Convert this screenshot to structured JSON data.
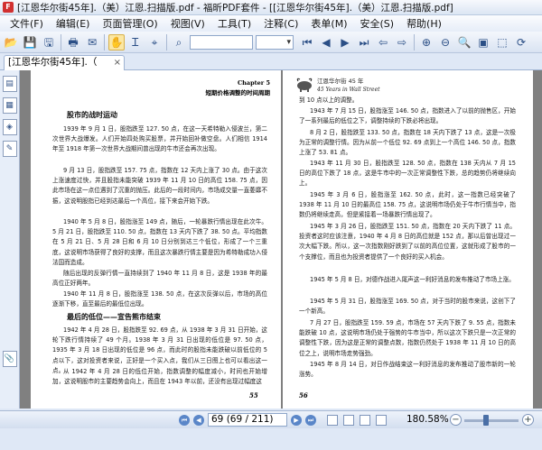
{
  "window": {
    "title": "[江恩华尔街45年].（美）江恩.扫描版.pdf - 福昕PDF套件 - [[江恩华尔街45年].（美）江恩.扫描版.pdf]"
  },
  "menu": [
    "文件(F)",
    "编辑(E)",
    "页面管理(O)",
    "视图(V)",
    "工具(T)",
    "注释(C)",
    "表单(M)",
    "安全(S)",
    "帮助(H)"
  ],
  "toolbar": {
    "search_placeholder": "",
    "zoom_select": ""
  },
  "tab": {
    "label": "[江恩华尔街45年].（",
    "close": "×"
  },
  "left_page": {
    "chapter": "Chapter 5",
    "chapter_sub": "短期价格调整的时间周期",
    "section1": "股市的战时运动",
    "p1": "1939 年 9 月 1 日，股指跌至 127. 50 点，在这一天希特勒入侵波兰，第二次世界大战爆发。人们开始四处购买股票，并开始回补做空盘。人们相信 1914 年至 1918 年第一次世界大战期间曾出现的牛市还会再次出现。",
    "p2": "9 月 13 日，股指跌至 157. 75 点，指数在 12 天内上涨了 30 点。由于这次上涨速度过快，并且股指未能突破 1939 年 11 月 10 日的高位 158. 75 点，因此市场在这一点位遇到了沉重的抛压。此后的一段时间内，市场成交量一直萎靡不振，这说明股指已经到达最后一个高位，接下来会开始下跌。",
    "p3": "1940 年 5 月 8 日，股指涨至 149 点，随后，一轮暴跌行情出现在此次牛。5 月 21 日，股指跌至 110. 50 点，指数在 13 天内下跌了 38. 50 点。平均指数在 5 月 21 日、5 月 28 日和 6 月 10 日分别到达三个低位，形成了一个三重底，这说明市场获得了良好的支撑，而且这次暴跌行情主要是因为希特勒成功入侵法国而造成。",
    "p4": "随后出现的反弹行情一直持续到了 1940 年 11 月 8 日，这是 1938 年的最高位正好两年。",
    "p5": "1940 年 11 月 8 日，股指涨至 138. 50 点，在这次反弹以后，市场的高位逐渐下移，直至最后的最低位出现。",
    "section2": "最后的低位——宣告熊市结束",
    "p6": "1942 年 4 月 28 日，股指跌至 92. 69 点，从 1938 年 3 月 31 日开始，这轮下跌行情持续了 49 个月。1938 年 3 月 31 日出现的低位是 97. 50 点，1935 年 3 月 18 日出现的低位是 96 点，而此时的股指未能跌破以前低位的 5 点以下，这对投资者来说，正好是一个买入点，我们从三日图上也可以看出这一点。",
    "p7": "从 1942 年 4 月 28 日的低位开始，指数调整的幅度减小，时间也开始增加，这说明股市的主要趋势会向上，而且在 1943 年以前，还没有出现过幅度这",
    "page_no": "55"
  },
  "right_page": {
    "header_cn": "江恩华尔街 45 年",
    "header_en": "45 Years in Wall Street",
    "p1": "到 10 点以上的调整。",
    "p2": "1943 年 7 月 15 日，股指涨至 146. 50 点，指数进入了以前的抛售区，开始了一系列最后的低位之下，调整持续的下跌必将出现。",
    "p3": "8 月 2 日，股指跌至 133. 50 点，指数在 18 天内下跌了 13 点，这是一次极为正常的调整行情。因为从前一个低位 92. 69 点到上一个高位 146. 50 点，指数上涨了 53. 81 点。",
    "p4": "1943 年 11 月 30 日，股指跌至 128. 50 点，指数在 138 天内从 7 月 15 日的高位下跌了 18 点，这是牛市中的一次正常调整性下跌，总的趋势仍将继续向上。",
    "p5": "1945 年 3 月 6 日，股指涨至 162. 50 点，此时，这一指数已经突破了 1938 年 11 月 10 日的最高位 158. 75 点，这说明市场仍处于牛市行情当中，指数仍将继续走高，但是紧接着一场暴跌行情出现了。",
    "p6": "1945 年 3 月 26 日，股指跌至 151. 50 点，指数在 20 天内下跌了 11 点。投资者这时应该注意，1940 年 4 月 8 日的高位就是 152 点，那以后曾出现过一次大幅下跌。所以，这一次指数刚好跌到了以前的高位位置，这就形成了股市的一个支撑位，而且也为投资者提供了一个良好的买入机会。",
    "p7": "1945 年 5 月 8 日，对德作战进入尾声这一利好消息的发布推动了市场上涨。",
    "p8": "1945 年 5 月 31 日，股指涨至 169. 50 点，对于当时的股市来说，这创下了一个新高。",
    "p9": "7 月 27 日，股指跌至 159. 59 点，市场在 57 天内下跌了 9. 55 点，指数未能跌破 10 点，这说明市场仍处于强势的牛市当中，所以这次下跌只是一次正常的调整性下跌，因为这是正常的调整点数，指数仍然处于 1938 年 11 月 10 日的高位之上，说明市场走势强劲。",
    "p10": "1945 年 8 月 14 日，对日作战结束这一利好消息的发布推动了股市新的一轮涨势。",
    "page_no": "56"
  },
  "status": {
    "page_field": "69 (69 / 211)",
    "zoom": "180.58%"
  }
}
